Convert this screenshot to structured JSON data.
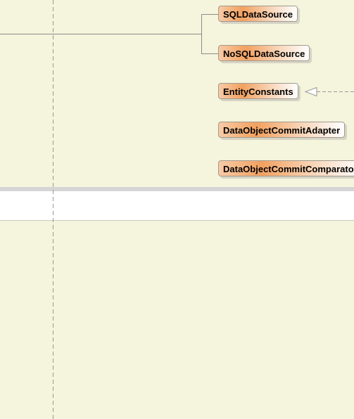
{
  "diagram": {
    "nodes": [
      {
        "label": "SQLDataSource"
      },
      {
        "label": "NoSQLDataSource"
      },
      {
        "label": "EntityConstants"
      },
      {
        "label": "DataObjectCommitAdapter"
      },
      {
        "label": "DataObjectCommitComparator"
      }
    ],
    "colors": {
      "background": "#f5f4dc",
      "node_accent": "#f2a160",
      "edge": "#8c8c8c"
    }
  }
}
